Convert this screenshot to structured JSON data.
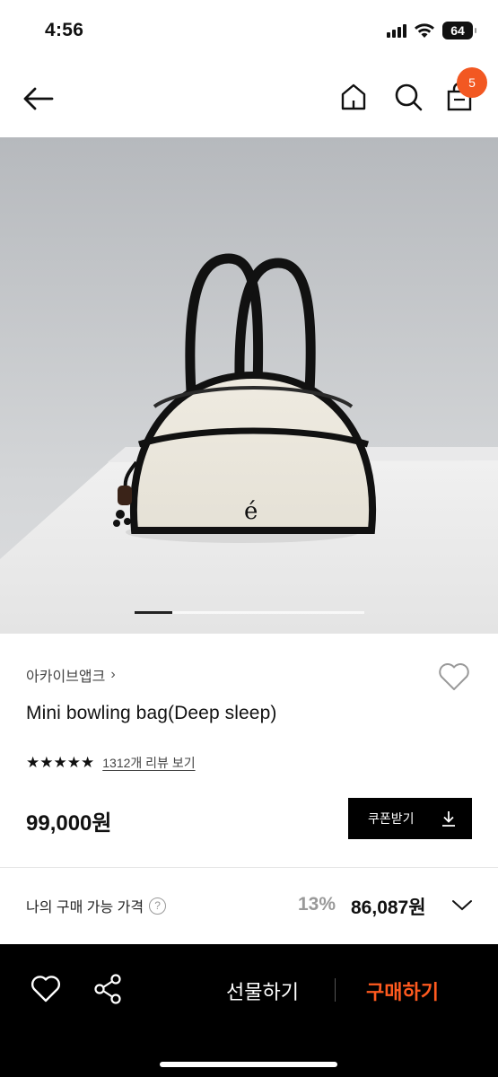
{
  "status_bar": {
    "time": "4:56",
    "battery": "64",
    "icons": [
      "signal-icon",
      "wifi-icon",
      "battery-icon"
    ]
  },
  "nav": {
    "icons": [
      "back-arrow-icon",
      "home-icon",
      "search-icon",
      "cart-icon"
    ],
    "cart_badge": "5",
    "badge_color": "#f25822"
  },
  "hero": {
    "slide_indicator": {
      "active_index": 1
    },
    "logo_mark": "é"
  },
  "product": {
    "brand": "아카이브앱크",
    "brand_chevron": "›",
    "title": "Mini bowling bag(Deep sleep)",
    "rating_stars": 5,
    "review_link": "1312개 리뷰 보기",
    "price": "99,000원",
    "coupon_label": "쿠폰받기"
  },
  "my_price": {
    "label": "나의 구매 가능 가격",
    "help_symbol": "?",
    "discount": "13%",
    "price": "86,087원"
  },
  "action_bar": {
    "gift_label": "선물하기",
    "buy_label": "구매하기",
    "buy_color": "#ff5a1f",
    "icons": [
      "heart-icon",
      "share-icon"
    ]
  }
}
